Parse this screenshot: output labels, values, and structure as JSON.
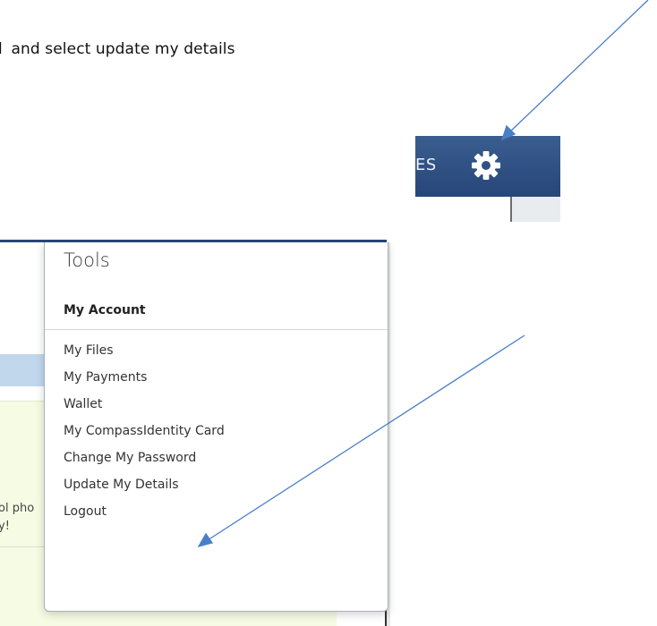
{
  "instruction": {
    "cut_char": "l",
    "text": " and select update my details"
  },
  "navbar": {
    "partial_label": "ES",
    "icon": "gear-icon",
    "bar_color": "#2f5185"
  },
  "menu": {
    "title": "Tools",
    "section": "My Account",
    "items": [
      {
        "label": "My Files"
      },
      {
        "label": "My Payments"
      },
      {
        "label": "Wallet"
      },
      {
        "label": "My CompassIdentity Card"
      },
      {
        "label": "Change My Password"
      },
      {
        "label": "Update My Details"
      },
      {
        "label": "Logout"
      }
    ]
  },
  "background": {
    "notice_line1": "ol pho",
    "notice_line2": "y!"
  },
  "annotation": {
    "arrow_color": "#4a7fc7"
  }
}
